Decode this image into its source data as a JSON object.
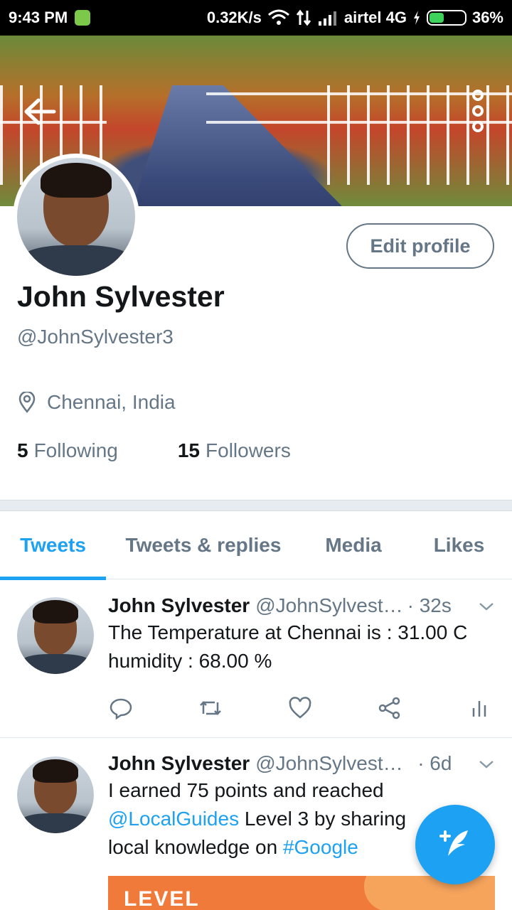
{
  "status_bar": {
    "time": "9:43 PM",
    "speed": "0.32K/s",
    "carrier": "airtel 4G",
    "battery": "36%"
  },
  "header": {
    "back_icon": "arrow-left-icon",
    "more_icon": "more-vertical-icon"
  },
  "profile": {
    "edit_button": "Edit profile",
    "name": "John Sylvester",
    "handle": "@JohnSylvester3",
    "location": "Chennai, India",
    "following_count": "5",
    "following_label": "Following",
    "followers_count": "15",
    "followers_label": "Followers"
  },
  "tabs": [
    {
      "label": "Tweets",
      "active": true
    },
    {
      "label": "Tweets & replies",
      "active": false
    },
    {
      "label": "Media",
      "active": false
    },
    {
      "label": "Likes",
      "active": false
    }
  ],
  "tweets": [
    {
      "name": "John Sylvester",
      "handle": "@JohnSylvest…",
      "time": "· 32s",
      "line1": "The Temperature at Chennai is : 31.00 C",
      "line2": "humidity : 68.00 %"
    },
    {
      "name": "John Sylvester",
      "handle": "@JohnSylveste…",
      "time": "· 6d",
      "line1": "I earned 75 points and reached",
      "mention": "@LocalGuides",
      "line2_rest": " Level 3 by sharing",
      "line3": "local knowledge on ",
      "hashtag": "#Google",
      "image_text": "LEVEL"
    }
  ],
  "colors": {
    "accent": "#1da1f2",
    "secondary_text": "#657786",
    "primary_text": "#14171a"
  },
  "fab_icon": "compose-tweet-icon"
}
